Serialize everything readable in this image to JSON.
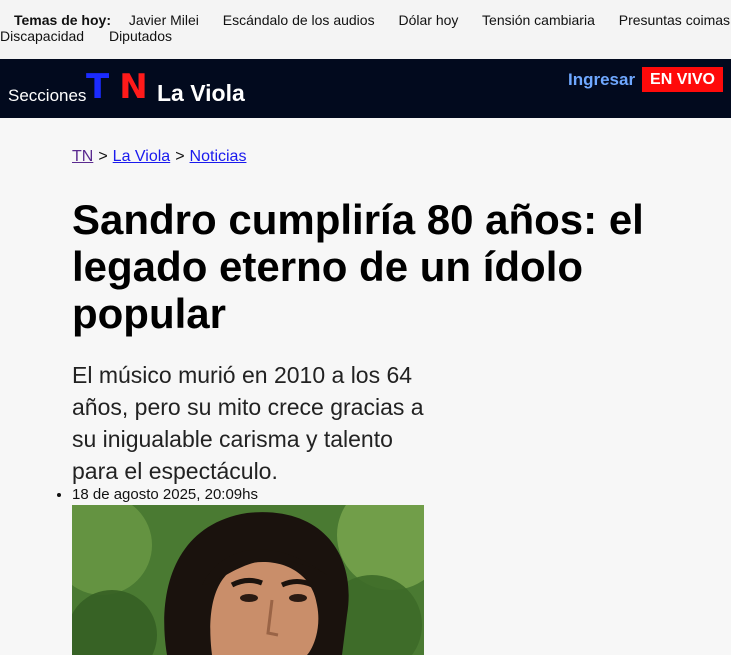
{
  "topics": {
    "label": "Temas de hoy:",
    "items": [
      "Javier Milei",
      "Escándalo de los audios",
      "Dólar hoy",
      "Tensión cambiaria",
      "Presuntas coimas en",
      "Discapacidad",
      "Diputados"
    ]
  },
  "header": {
    "menu_label": "Secciones",
    "logo_t": "T",
    "logo_n": "N",
    "section_name": "La Viola",
    "login_label": "Ingresar",
    "live_label": "EN VIVO"
  },
  "breadcrumb": {
    "items": [
      "TN",
      "La Viola",
      "Noticias"
    ],
    "separator": ">"
  },
  "article": {
    "title": "Sandro cumpliría 80 años: el legado eterno de un ídolo popular",
    "subtitle": "El músico murió en 2010 a los 64 años, pero su mito crece gracias a su inigualable carisma y talento para el espectáculo.",
    "date": "18 de agosto 2025, 20:09hs"
  },
  "colors": {
    "header_bg": "#020a1e",
    "logo_t": "#1b2bff",
    "logo_n": "#ff1a1a",
    "live_bg": "#ff0a0a",
    "login": "#6fa8ff"
  }
}
